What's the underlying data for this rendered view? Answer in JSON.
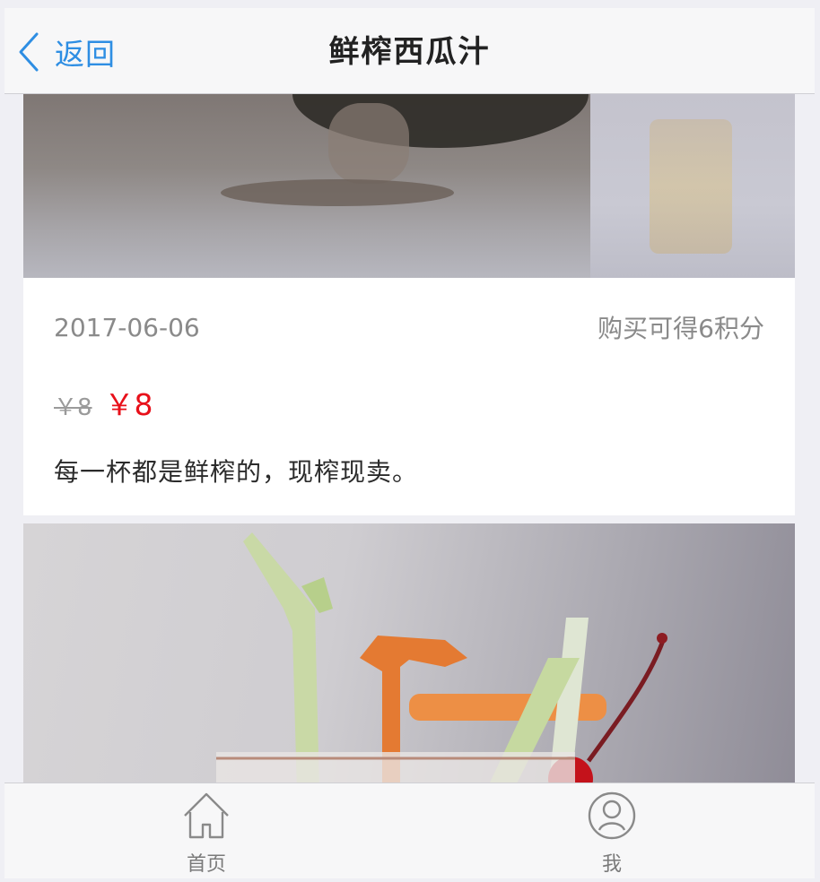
{
  "header": {
    "back_label": "返回",
    "title": "鲜榨西瓜汁"
  },
  "product": {
    "date": "2017-06-06",
    "points": "购买可得6积分",
    "old_price": "￥8",
    "new_price": "￥8",
    "description": "每一杯都是鲜榨的，现榨现卖。"
  },
  "tabs": [
    {
      "label": "首页",
      "icon": "home-icon"
    },
    {
      "label": "我",
      "icon": "user-icon"
    }
  ],
  "colors": {
    "accent": "#2e8ee3",
    "price": "#e8101a"
  }
}
